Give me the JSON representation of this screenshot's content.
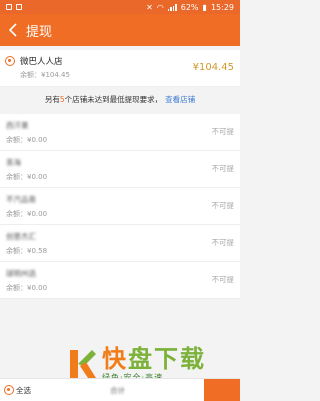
{
  "status": {
    "percent": "62%",
    "time": "15:29"
  },
  "header": {
    "title": "提现"
  },
  "store": {
    "name": "微巴人人店",
    "balance": "余额：¥104.45",
    "amount": "¥104.45"
  },
  "notice": {
    "prefix": "另有",
    "count": "5",
    "suffix": "个店铺未达到最低提现要求，",
    "link": "查看店铺"
  },
  "rows": [
    {
      "name": "西汗果",
      "balance": "余额：¥0.00",
      "status": "不可提"
    },
    {
      "name": "茶海",
      "balance": "余额：¥0.00",
      "status": "不可提"
    },
    {
      "name": "不汽品易",
      "balance": "余额：¥0.00",
      "status": "不可提"
    },
    {
      "name": "创意杰汇",
      "balance": "余额：¥0.58",
      "status": "不可提"
    },
    {
      "name": "球明州选",
      "balance": "余额：¥0.00",
      "status": "不可提"
    }
  ],
  "footer": {
    "select_all": "全选",
    "total": "合计"
  },
  "watermark": {
    "brand": "快",
    "brand_rest": "盘下载",
    "tagline": "绿色·安全·高速"
  },
  "colors": {
    "accent": "#ef6d25",
    "amount": "#d09a2a",
    "link": "#3a7bd5"
  }
}
